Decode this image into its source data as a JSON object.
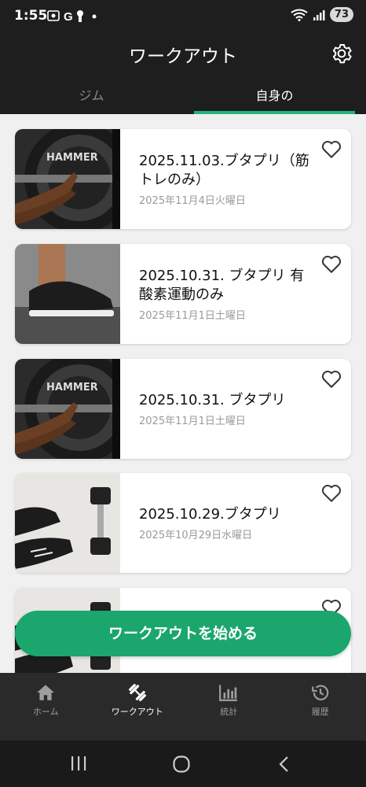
{
  "status_bar": {
    "time": "1:55",
    "battery": "73",
    "left_icons": [
      "screenshot-icon",
      "google-icon",
      "keyhole-icon",
      "dot-icon"
    ]
  },
  "header": {
    "title": "ワークアウト"
  },
  "tabs": [
    {
      "label": "ジム",
      "active": false
    },
    {
      "label": "自身の",
      "active": true
    }
  ],
  "workouts": [
    {
      "title": "2025.11.03.ブタプリ（筋トレのみ）",
      "date": "2025年11月4日火曜日",
      "image": "hammer-plate-photo"
    },
    {
      "title": "2025.10.31. ブタプリ 有酸素運動のみ",
      "date": "2025年11月1日土曜日",
      "image": "sneaker-photo"
    },
    {
      "title": "2025.10.31. ブタプリ",
      "date": "2025年11月1日土曜日",
      "image": "hammer-plate-photo"
    },
    {
      "title": "2025.10.29.ブタプリ",
      "date": "2025年10月29日水曜日",
      "image": "dumbbell-shoes-photo"
    },
    {
      "title": "",
      "date": "",
      "image": "dumbbell-shoes-photo"
    }
  ],
  "fab": {
    "label": "ワークアウトを始める"
  },
  "bottom_nav": [
    {
      "label": "ホーム",
      "icon": "home-icon",
      "active": false
    },
    {
      "label": "ワークアウト",
      "icon": "dumbbell-icon",
      "active": true
    },
    {
      "label": "統計",
      "icon": "stats-icon",
      "active": false
    },
    {
      "label": "履歴",
      "icon": "history-icon",
      "active": false
    }
  ],
  "colors": {
    "accent": "#1aa66c",
    "tab_indicator": "#22b57a",
    "bar": "#1e1e1e",
    "nav": "#2a2a2a"
  }
}
